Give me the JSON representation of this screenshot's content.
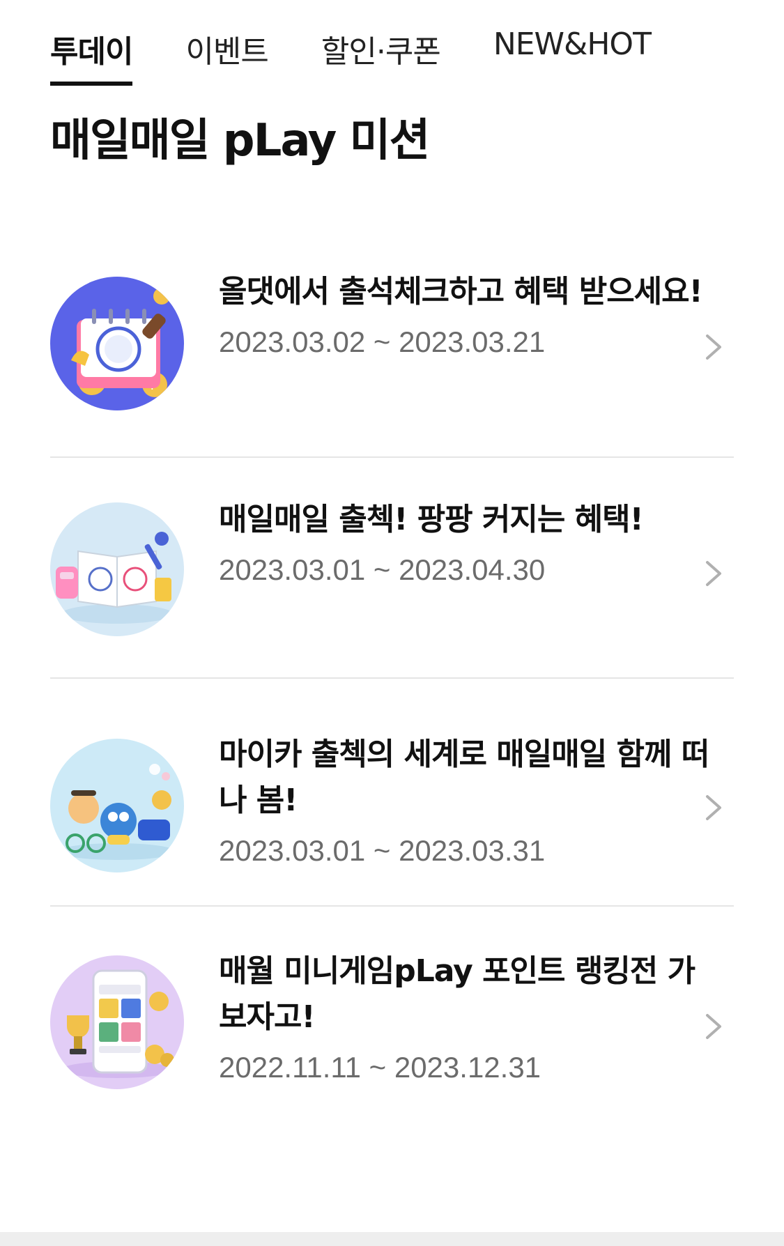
{
  "tabs": [
    {
      "label": "투데이",
      "active": true
    },
    {
      "label": "이벤트",
      "active": false
    },
    {
      "label": "할인·쿠폰",
      "active": false
    },
    {
      "label": "NEW&HOT",
      "active": false
    }
  ],
  "section_title": "매일매일 pLay 미션",
  "missions": [
    {
      "title": "올댓에서 출석체크하고 혜택 받으세요!",
      "date": "2023.03.02 ~ 2023.03.21",
      "icon": "calendar-stamp-icon"
    },
    {
      "title": "매일매일 출첵! 팡팡 커지는 혜택!",
      "date": "2023.03.01 ~ 2023.04.30",
      "icon": "open-book-stamp-icon"
    },
    {
      "title": "마이카 출첵의 세계로 매일매일 함께 떠나 봄!",
      "date": "2023.03.01 ~ 2023.03.31",
      "icon": "characters-icon"
    },
    {
      "title": "매월 미니게임pLay 포인트 랭킹전 가보자고!",
      "date": "2022.11.11 ~ 2023.12.31",
      "icon": "phone-trophy-icon"
    }
  ],
  "colors": {
    "thumb1_bg": "#5a63e8",
    "thumb2_bg": "#d6e9f6",
    "thumb3_bg": "#cdeaf7",
    "thumb4_bg": "#e2cdf6",
    "divider": "#e5e5e5",
    "date_text": "#6b6b6b"
  }
}
